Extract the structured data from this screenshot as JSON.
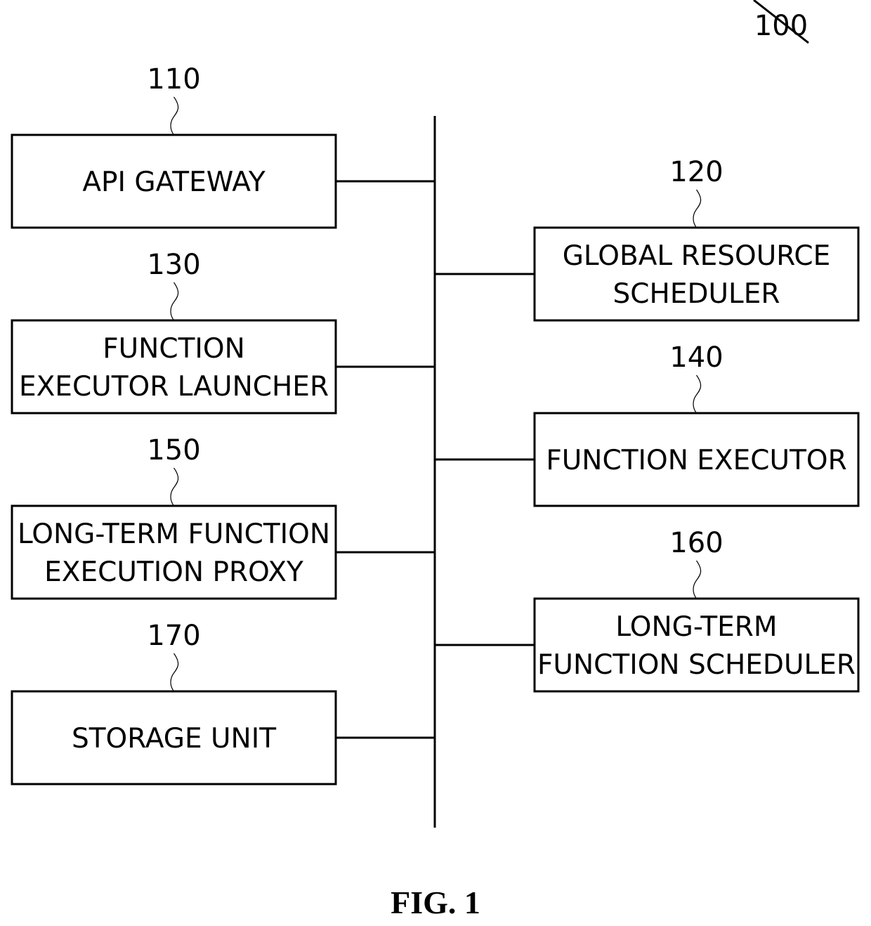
{
  "figure": {
    "reference_number": "100",
    "caption": "FIG. 1"
  },
  "components": [
    {
      "id": "api-gateway",
      "ref": "110",
      "lines": [
        "API GATEWAY"
      ],
      "side": "left"
    },
    {
      "id": "global-resource-scheduler",
      "ref": "120",
      "lines": [
        "GLOBAL RESOURCE",
        "SCHEDULER"
      ],
      "side": "right"
    },
    {
      "id": "function-executor-launcher",
      "ref": "130",
      "lines": [
        "FUNCTION",
        "EXECUTOR LAUNCHER"
      ],
      "side": "left"
    },
    {
      "id": "function-executor",
      "ref": "140",
      "lines": [
        "FUNCTION EXECUTOR"
      ],
      "side": "right"
    },
    {
      "id": "long-term-function-execution-proxy",
      "ref": "150",
      "lines": [
        "LONG-TERM FUNCTION",
        "EXECUTION PROXY"
      ],
      "side": "left"
    },
    {
      "id": "long-term-function-scheduler",
      "ref": "160",
      "lines": [
        "LONG-TERM",
        "FUNCTION SCHEDULER"
      ],
      "side": "right"
    },
    {
      "id": "storage-unit",
      "ref": "170",
      "lines": [
        "STORAGE UNIT"
      ],
      "side": "left"
    }
  ],
  "connections": {
    "type": "shared-bus",
    "connected": [
      "api-gateway",
      "global-resource-scheduler",
      "function-executor-launcher",
      "function-executor",
      "long-term-function-execution-proxy",
      "long-term-function-scheduler",
      "storage-unit"
    ]
  }
}
